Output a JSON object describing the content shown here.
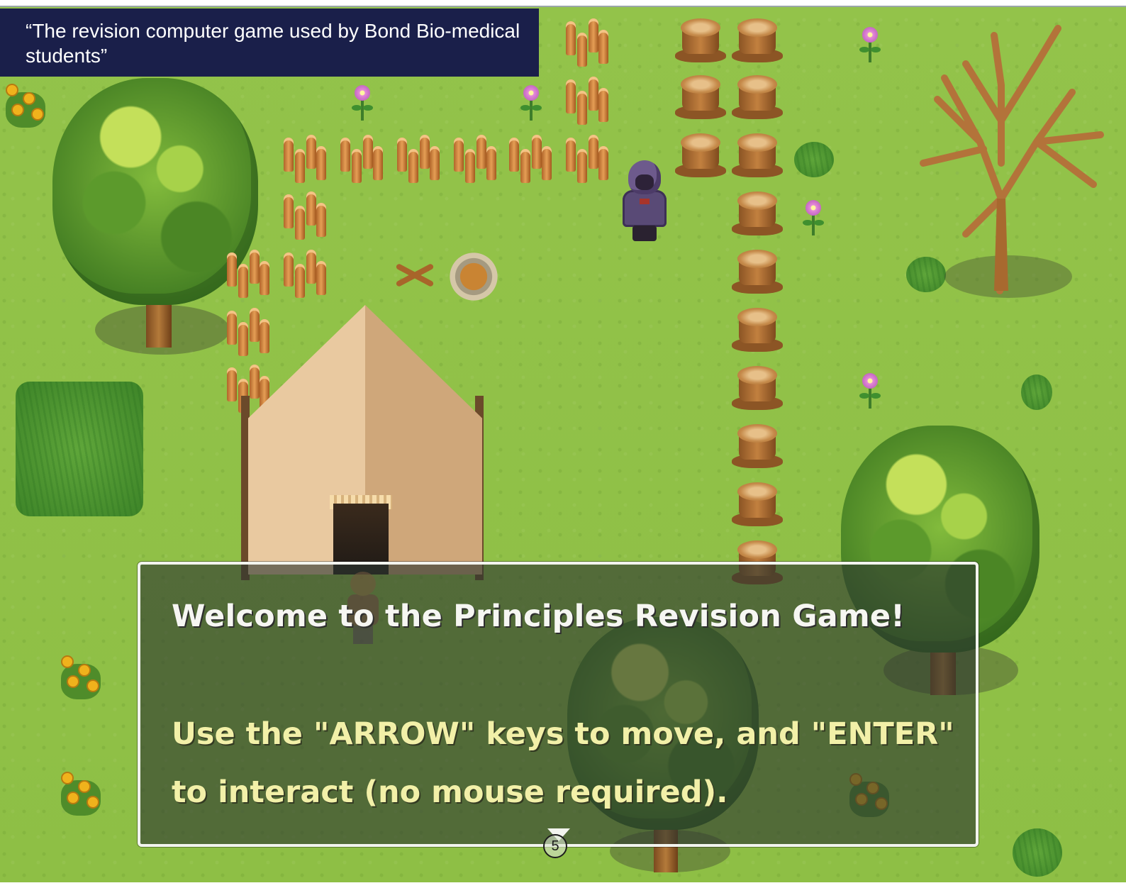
{
  "caption": {
    "text": "“The revision computer game used by Bond Bio-medical students”"
  },
  "dialog": {
    "title": "Welcome to the Principles Revision Game!",
    "line1": "Use the \"ARROW\" keys to move, and \"ENTER\"",
    "line2": "to interact (no mouse required)."
  },
  "slide": {
    "page_number": "5"
  },
  "scene": {
    "colors": {
      "grass": "#8ebf45",
      "caption_bg": "#1a1f4a",
      "dialog_text": "#f2f0a8",
      "dialog_title_text": "#f6f6f2"
    },
    "icons": [
      "player-character-icon",
      "npc-character-icon",
      "tent-icon",
      "campfire-icon",
      "tree-stump-icon",
      "log-stack-icon",
      "flower-icon",
      "tree-icon",
      "dialog-continue-icon"
    ]
  }
}
